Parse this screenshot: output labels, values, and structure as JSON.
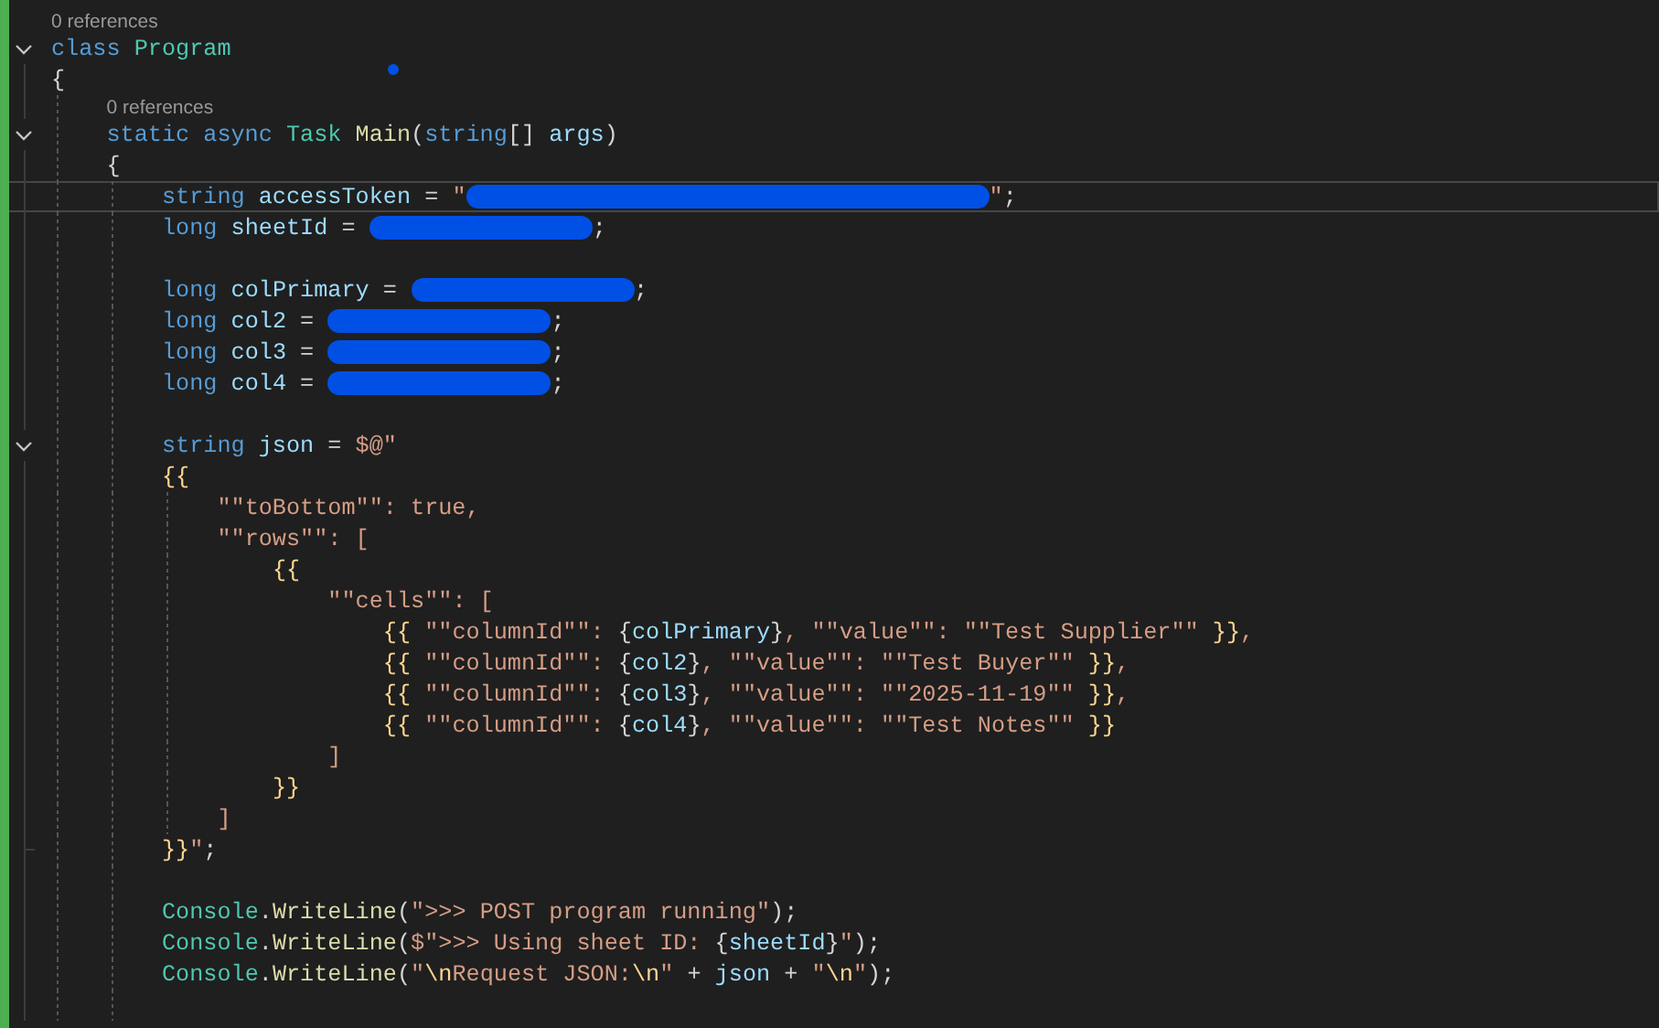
{
  "editor": {
    "lines": [
      {
        "kind": "codelens",
        "text": "0 references"
      },
      {
        "kind": "code",
        "fold": true,
        "tokens": [
          {
            "kind": "keyword",
            "text": "class "
          },
          {
            "kind": "type",
            "text": "Program"
          }
        ]
      },
      {
        "kind": "code",
        "tokens": [
          {
            "kind": "plain",
            "text": "{"
          }
        ],
        "children": [
          {
            "kind": "codelens",
            "text": "0 references"
          },
          {
            "kind": "code",
            "fold": true,
            "tokens": [
              {
                "kind": "keyword",
                "text": "static async "
              },
              {
                "kind": "type",
                "text": "Task "
              },
              {
                "kind": "method",
                "text": "Main"
              },
              {
                "kind": "plain",
                "text": "("
              },
              {
                "kind": "keyword",
                "text": "string"
              },
              {
                "kind": "plain",
                "text": "[] "
              },
              {
                "kind": "variable",
                "text": "args"
              },
              {
                "kind": "plain",
                "text": ")"
              }
            ]
          },
          {
            "kind": "code",
            "tokens": [
              {
                "kind": "plain",
                "text": "{"
              }
            ],
            "children": [
              {
                "kind": "code",
                "current": true,
                "tokens": [
                  {
                    "kind": "keyword",
                    "text": "string "
                  },
                  {
                    "kind": "variable",
                    "text": "accessToken"
                  },
                  {
                    "kind": "plain",
                    "text": " = "
                  },
                  {
                    "kind": "string",
                    "text": "\""
                  },
                  {
                    "kind": "wide_redaction"
                  },
                  {
                    "kind": "string",
                    "text": "\""
                  },
                  {
                    "kind": "plain",
                    "text": ";"
                  }
                ]
              },
              {
                "kind": "code",
                "tokens": [
                  {
                    "kind": "keyword",
                    "text": "long "
                  },
                  {
                    "kind": "variable",
                    "text": "sheetId"
                  },
                  {
                    "kind": "plain",
                    "text": " = "
                  },
                  {
                    "kind": "redaction"
                  },
                  {
                    "kind": "plain",
                    "text": ";"
                  }
                ]
              },
              {
                "kind": "blank"
              },
              {
                "kind": "code",
                "tokens": [
                  {
                    "kind": "keyword",
                    "text": "long "
                  },
                  {
                    "kind": "variable",
                    "text": "colPrimary"
                  },
                  {
                    "kind": "plain",
                    "text": " = "
                  },
                  {
                    "kind": "redaction"
                  },
                  {
                    "kind": "plain",
                    "text": ";"
                  }
                ]
              },
              {
                "kind": "code",
                "tokens": [
                  {
                    "kind": "keyword",
                    "text": "long "
                  },
                  {
                    "kind": "variable",
                    "text": "col2"
                  },
                  {
                    "kind": "plain",
                    "text": " = "
                  },
                  {
                    "kind": "redaction"
                  },
                  {
                    "kind": "plain",
                    "text": ";"
                  }
                ]
              },
              {
                "kind": "code",
                "tokens": [
                  {
                    "kind": "keyword",
                    "text": "long "
                  },
                  {
                    "kind": "variable",
                    "text": "col3"
                  },
                  {
                    "kind": "plain",
                    "text": " = "
                  },
                  {
                    "kind": "redaction"
                  },
                  {
                    "kind": "plain",
                    "text": ";"
                  }
                ]
              },
              {
                "kind": "code",
                "tokens": [
                  {
                    "kind": "keyword",
                    "text": "long "
                  },
                  {
                    "kind": "variable",
                    "text": "col4"
                  },
                  {
                    "kind": "plain",
                    "text": " = "
                  },
                  {
                    "kind": "redaction"
                  },
                  {
                    "kind": "plain",
                    "text": ";"
                  }
                ]
              },
              {
                "kind": "blank"
              },
              {
                "kind": "code",
                "fold": true,
                "tokens": [
                  {
                    "kind": "keyword",
                    "text": "string "
                  },
                  {
                    "kind": "variable",
                    "text": "json"
                  },
                  {
                    "kind": "plain",
                    "text": " = "
                  },
                  {
                    "kind": "string",
                    "text": "$@\""
                  }
                ]
              },
              {
                "kind": "code",
                "tokens": [
                  {
                    "kind": "escape",
                    "text": "{{"
                  }
                ],
                "children": [
                  {
                    "kind": "code",
                    "tokens": [
                      {
                        "kind": "string",
                        "text": "\"\"toBottom\"\": true,"
                      }
                    ]
                  },
                  {
                    "kind": "code",
                    "tokens": [
                      {
                        "kind": "string",
                        "text": "\"\"rows\"\": ["
                      }
                    ],
                    "children": [
                      {
                        "kind": "code",
                        "tokens": [
                          {
                            "kind": "escape",
                            "text": "{{"
                          }
                        ],
                        "children": [
                          {
                            "kind": "code",
                            "tokens": [
                              {
                                "kind": "string",
                                "text": "\"\"cells\"\": ["
                              }
                            ],
                            "children": [
                              {
                                "kind": "code",
                                "tokens": [
                                  {
                                    "kind": "escape",
                                    "text": "{{"
                                  },
                                  {
                                    "kind": "string",
                                    "text": " \"\"columnId\"\": "
                                  },
                                  {
                                    "kind": "plain",
                                    "text": "{"
                                  },
                                  {
                                    "kind": "variable",
                                    "text": "colPrimary"
                                  },
                                  {
                                    "kind": "plain",
                                    "text": "}"
                                  },
                                  {
                                    "kind": "string",
                                    "text": ", \"\"value\"\": \"\"Test Supplier\"\" "
                                  },
                                  {
                                    "kind": "escape",
                                    "text": "}}"
                                  },
                                  {
                                    "kind": "string",
                                    "text": ","
                                  }
                                ]
                              },
                              {
                                "kind": "code",
                                "tokens": [
                                  {
                                    "kind": "escape",
                                    "text": "{{"
                                  },
                                  {
                                    "kind": "string",
                                    "text": " \"\"columnId\"\": "
                                  },
                                  {
                                    "kind": "plain",
                                    "text": "{"
                                  },
                                  {
                                    "kind": "variable",
                                    "text": "col2"
                                  },
                                  {
                                    "kind": "plain",
                                    "text": "}"
                                  },
                                  {
                                    "kind": "string",
                                    "text": ", \"\"value\"\": \"\"Test Buyer\"\" "
                                  },
                                  {
                                    "kind": "escape",
                                    "text": "}}"
                                  },
                                  {
                                    "kind": "string",
                                    "text": ","
                                  }
                                ]
                              },
                              {
                                "kind": "code",
                                "tokens": [
                                  {
                                    "kind": "escape",
                                    "text": "{{"
                                  },
                                  {
                                    "kind": "string",
                                    "text": " \"\"columnId\"\": "
                                  },
                                  {
                                    "kind": "plain",
                                    "text": "{"
                                  },
                                  {
                                    "kind": "variable",
                                    "text": "col3"
                                  },
                                  {
                                    "kind": "plain",
                                    "text": "}"
                                  },
                                  {
                                    "kind": "string",
                                    "text": ", \"\"value\"\": \"\"2025-11-19\"\" "
                                  },
                                  {
                                    "kind": "escape",
                                    "text": "}}"
                                  },
                                  {
                                    "kind": "string",
                                    "text": ","
                                  }
                                ]
                              },
                              {
                                "kind": "code",
                                "tokens": [
                                  {
                                    "kind": "escape",
                                    "text": "{{"
                                  },
                                  {
                                    "kind": "string",
                                    "text": " \"\"columnId\"\": "
                                  },
                                  {
                                    "kind": "plain",
                                    "text": "{"
                                  },
                                  {
                                    "kind": "variable",
                                    "text": "col4"
                                  },
                                  {
                                    "kind": "plain",
                                    "text": "}"
                                  },
                                  {
                                    "kind": "string",
                                    "text": ", \"\"value\"\": \"\"Test Notes\"\" "
                                  },
                                  {
                                    "kind": "escape",
                                    "text": "}}"
                                  }
                                ]
                              }
                            ]
                          },
                          {
                            "kind": "code",
                            "tokens": [
                              {
                                "kind": "string",
                                "text": "]"
                              }
                            ]
                          }
                        ]
                      },
                      {
                        "kind": "code",
                        "tokens": [
                          {
                            "kind": "escape",
                            "text": "}}"
                          }
                        ]
                      }
                    ]
                  },
                  {
                    "kind": "code",
                    "tokens": [
                      {
                        "kind": "string",
                        "text": "]"
                      }
                    ]
                  }
                ]
              },
              {
                "kind": "code",
                "fold_end": true,
                "tokens": [
                  {
                    "kind": "escape",
                    "text": "}}"
                  },
                  {
                    "kind": "string",
                    "text": "\""
                  },
                  {
                    "kind": "plain",
                    "text": ";"
                  }
                ]
              },
              {
                "kind": "blank"
              },
              {
                "kind": "code",
                "tokens": [
                  {
                    "kind": "type",
                    "text": "Console"
                  },
                  {
                    "kind": "plain",
                    "text": "."
                  },
                  {
                    "kind": "method",
                    "text": "WriteLine"
                  },
                  {
                    "kind": "plain",
                    "text": "("
                  },
                  {
                    "kind": "string",
                    "text": "\">>> POST program running\""
                  },
                  {
                    "kind": "plain",
                    "text": ");"
                  }
                ]
              },
              {
                "kind": "code",
                "tokens": [
                  {
                    "kind": "type",
                    "text": "Console"
                  },
                  {
                    "kind": "plain",
                    "text": "."
                  },
                  {
                    "kind": "method",
                    "text": "WriteLine"
                  },
                  {
                    "kind": "plain",
                    "text": "("
                  },
                  {
                    "kind": "string",
                    "text": "$\">>> Using sheet ID: "
                  },
                  {
                    "kind": "plain",
                    "text": "{"
                  },
                  {
                    "kind": "variable",
                    "text": "sheetId"
                  },
                  {
                    "kind": "plain",
                    "text": "}"
                  },
                  {
                    "kind": "string",
                    "text": "\""
                  },
                  {
                    "kind": "plain",
                    "text": ");"
                  }
                ]
              },
              {
                "kind": "code",
                "tokens": [
                  {
                    "kind": "type",
                    "text": "Console"
                  },
                  {
                    "kind": "plain",
                    "text": "."
                  },
                  {
                    "kind": "method",
                    "text": "WriteLine"
                  },
                  {
                    "kind": "plain",
                    "text": "("
                  },
                  {
                    "kind": "string",
                    "text": "\""
                  },
                  {
                    "kind": "escape",
                    "text": "\\n"
                  },
                  {
                    "kind": "string",
                    "text": "Request JSON:"
                  },
                  {
                    "kind": "escape",
                    "text": "\\n"
                  },
                  {
                    "kind": "string",
                    "text": "\""
                  },
                  {
                    "kind": "plain",
                    "text": " + "
                  },
                  {
                    "kind": "variable",
                    "text": "json"
                  },
                  {
                    "kind": "plain",
                    "text": " + "
                  },
                  {
                    "kind": "string",
                    "text": "\""
                  },
                  {
                    "kind": "escape",
                    "text": "\\n"
                  },
                  {
                    "kind": "string",
                    "text": "\""
                  },
                  {
                    "kind": "plain",
                    "text": ");"
                  }
                ]
              },
              {
                "kind": "blank"
              }
            ]
          }
        ]
      }
    ]
  }
}
